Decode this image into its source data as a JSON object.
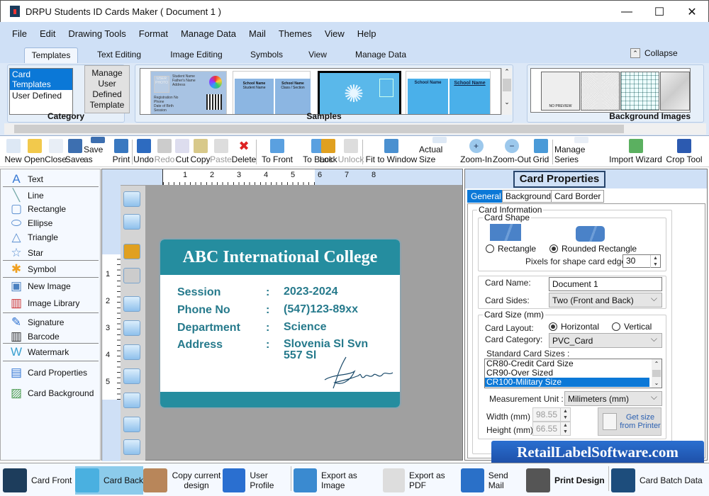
{
  "window": {
    "title": "DRPU Students ID Cards Maker ( Document 1 )",
    "minimize": "—",
    "maximize": "☐",
    "close": "✕"
  },
  "menu": [
    "File",
    "Edit",
    "Drawing Tools",
    "Format",
    "Manage Data",
    "Mail",
    "Themes",
    "View",
    "Help"
  ],
  "ribbon_tabs": {
    "items": [
      "Templates",
      "Text Editing",
      "Image Editing",
      "Symbols",
      "View",
      "Manage Data"
    ],
    "active": "Templates",
    "collapse": "Collapse"
  },
  "ribbon": {
    "category": {
      "label": "Category",
      "items": [
        "Card Templates",
        "User Defined"
      ],
      "selected": "Card Templates",
      "manage_button": "Manage User Defined Template"
    },
    "samples": {
      "label": "Samples",
      "thumb1": {
        "student_name": "Student Name",
        "fathers_name": "Father's Name",
        "address": "Address",
        "registration": "Registration No",
        "phone": "Phone",
        "dob": "Date of Birth",
        "session": "Session",
        "photo": "USER PHOTO"
      },
      "thumb2": {
        "school": "School Name",
        "student": "Student Name",
        "class": "Class / Section"
      }
    },
    "background_images": {
      "label": "Background Images",
      "no_preview": "NO PREVIEW"
    }
  },
  "toolbar": [
    {
      "label": "New",
      "icon": "new-file-icon"
    },
    {
      "label": "Open",
      "icon": "open-folder-icon"
    },
    {
      "label": "Close",
      "icon": "close-file-icon"
    },
    {
      "label": "Save",
      "icon": "save-icon"
    },
    {
      "label": "Save as",
      "icon": "save-as-icon"
    },
    {
      "label": "Print",
      "icon": "print-icon"
    },
    {
      "label": "Undo",
      "icon": "undo-icon"
    },
    {
      "label": "Redo",
      "icon": "redo-icon",
      "disabled": true
    },
    {
      "label": "Cut",
      "icon": "cut-icon"
    },
    {
      "label": "Copy",
      "icon": "copy-icon"
    },
    {
      "label": "Paste",
      "icon": "paste-icon",
      "disabled": true
    },
    {
      "label": "Delete",
      "icon": "delete-icon"
    },
    {
      "label": "To Front",
      "icon": "to-front-icon"
    },
    {
      "label": "To Back",
      "icon": "to-back-icon"
    },
    {
      "label": "Lock",
      "icon": "lock-icon"
    },
    {
      "label": "Unlock",
      "icon": "unlock-icon",
      "disabled": true
    },
    {
      "label": "Fit to Window",
      "icon": "fit-window-icon"
    },
    {
      "label": "Actual Size",
      "icon": "actual-size-icon"
    },
    {
      "label": "Zoom-In",
      "icon": "zoom-in-icon"
    },
    {
      "label": "Zoom-Out",
      "icon": "zoom-out-icon"
    },
    {
      "label": "Grid",
      "icon": "grid-icon"
    },
    {
      "label": "Manage Series",
      "icon": "manage-series-icon"
    },
    {
      "label": "Import Wizard",
      "icon": "import-wizard-icon"
    },
    {
      "label": "Crop Tool",
      "icon": "crop-icon"
    }
  ],
  "left_panel": [
    "Text",
    "Line",
    "Rectangle",
    "Ellipse",
    "Triangle",
    "Star",
    "Symbol",
    "New Image",
    "Image Library",
    "Signature",
    "Barcode",
    "Watermark",
    "Card Properties",
    "Card Background"
  ],
  "ruler": {
    "h": [
      "1",
      "2",
      "3",
      "4",
      "5",
      "6",
      "7",
      "8"
    ],
    "v": [
      "1",
      "2",
      "3",
      "4",
      "5"
    ]
  },
  "card": {
    "title": "ABC International College",
    "rows": [
      {
        "label": "Session",
        "value": "2023-2024"
      },
      {
        "label": "Phone No",
        "value": "(547)123-89xx"
      },
      {
        "label": "Department",
        "value": "Science"
      },
      {
        "label": "Address",
        "value": "Slovenia Sl Svn\n557 Sl"
      }
    ],
    "colon": ":",
    "accent": "#258d9f"
  },
  "properties": {
    "title": "Card Properties",
    "tabs": [
      "General",
      "Background",
      "Card Border"
    ],
    "active_tab": "General",
    "card_information": "Card Information",
    "card_shape": "Card Shape",
    "shape_rectangle": "Rectangle",
    "shape_rounded": "Rounded Rectangle",
    "shape_selected": "Rounded Rectangle",
    "edge_label": "Pixels for shape card edge :",
    "edge_value": "30",
    "card_name_label": "Card Name:",
    "card_name_value": "Document 1",
    "card_sides_label": "Card Sides:",
    "card_sides_value": "Two (Front and Back)",
    "card_size_label": "Card Size (mm)",
    "layout_label": "Card Layout:",
    "layout_horizontal": "Horizontal",
    "layout_vertical": "Vertical",
    "layout_selected": "Horizontal",
    "category_label": "Card Category:",
    "category_value": "PVC_Card",
    "standard_sizes_label": "Standard Card Sizes :",
    "standard_sizes": [
      "CR80-Credit Card Size",
      "CR90-Over Sized",
      "CR100-Military Size"
    ],
    "standard_selected": "CR100-Military Size",
    "unit_label": "Measurement Unit :",
    "unit_value": "Milimeters (mm)",
    "width_label": "Width  (mm)",
    "width_value": "98.55",
    "height_label": "Height  (mm)",
    "height_value": "66.55",
    "get_size_button": "Get size from Printer"
  },
  "brand": "RetailLabelSoftware.com",
  "bottom_bar": [
    {
      "label": "Card Front",
      "icon": "card-front-icon"
    },
    {
      "label": "Card Back",
      "icon": "card-back-icon",
      "active": true
    },
    {
      "label": "Copy current design",
      "icon": "copy-design-icon"
    },
    {
      "label": "User Profile",
      "icon": "user-profile-icon"
    },
    {
      "label": "Export as Image",
      "icon": "export-image-icon"
    },
    {
      "label": "Export as PDF",
      "icon": "export-pdf-icon"
    },
    {
      "label": "Send Mail",
      "icon": "send-mail-icon"
    },
    {
      "label": "Print Design",
      "icon": "print-design-icon"
    },
    {
      "label": "Card Batch Data",
      "icon": "card-batch-icon"
    }
  ]
}
